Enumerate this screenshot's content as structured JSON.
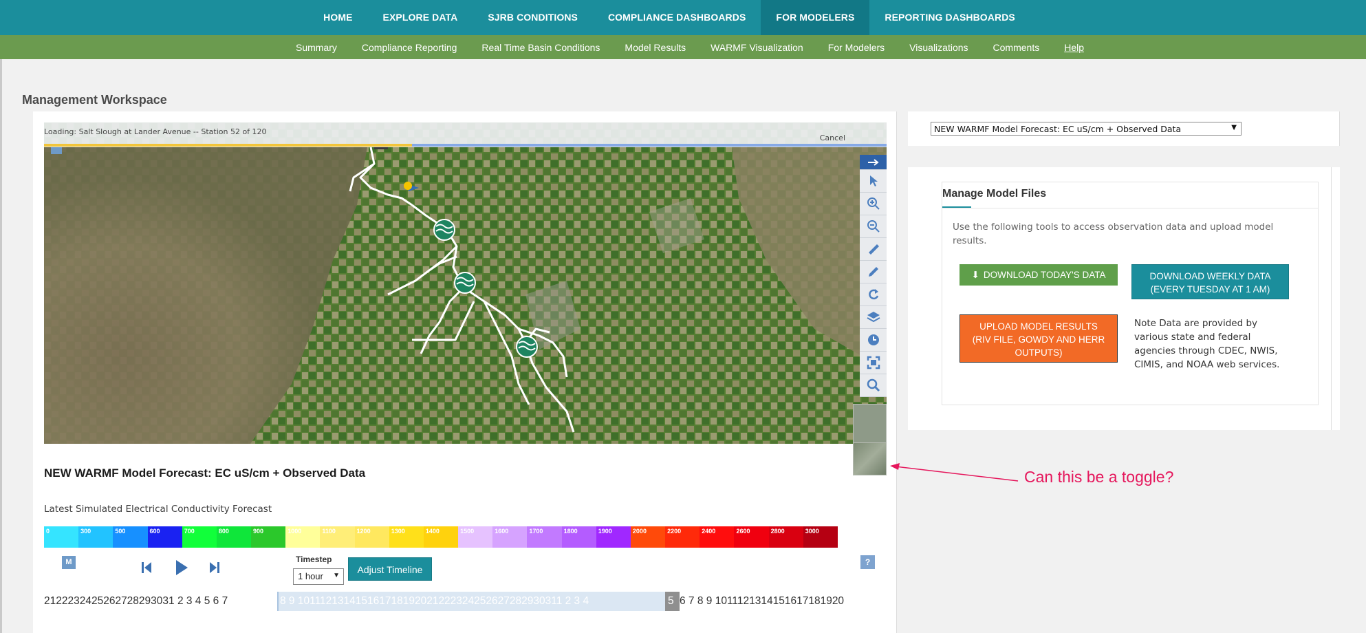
{
  "top_nav": {
    "items": [
      "HOME",
      "EXPLORE DATA",
      "SJRB CONDITIONS",
      "COMPLIANCE DASHBOARDS",
      "FOR MODELERS",
      "REPORTING DASHBOARDS"
    ],
    "active": "FOR MODELERS"
  },
  "sub_nav": {
    "items": [
      "Summary",
      "Compliance Reporting",
      "Real Time Basin Conditions",
      "Model Results",
      "WARMF Visualization",
      "For Modelers",
      "Visualizations",
      "Comments",
      "Help"
    ]
  },
  "workspace_title": "Management Workspace",
  "map": {
    "loading_text": "Loading: Salt Slough at Lander Avenue -- Station 52 of 120",
    "cancel_label": "Cancel",
    "loading_progress": 0.437,
    "tools": [
      "arrow-right-icon",
      "pointer-icon",
      "zoom-in-icon",
      "zoom-out-icon",
      "ruler-icon",
      "pencil-icon",
      "refresh-icon",
      "layers-icon",
      "clock-icon",
      "fullscreen-icon",
      "search-icon"
    ]
  },
  "chart_title": "NEW WARMF Model Forecast: EC uS/cm + Observed Data",
  "legend": {
    "label": "Latest Simulated Electrical Conductivity Forecast",
    "bins": [
      {
        "label": "0",
        "color": "#35e4ff"
      },
      {
        "label": "300",
        "color": "#22c3ff"
      },
      {
        "label": "500",
        "color": "#1790ff"
      },
      {
        "label": "600",
        "color": "#1a22f2"
      },
      {
        "label": "700",
        "color": "#11ff3a"
      },
      {
        "label": "800",
        "color": "#0fe63a"
      },
      {
        "label": "900",
        "color": "#2bc82b"
      },
      {
        "label": "1000",
        "color": "#ffff9a"
      },
      {
        "label": "1100",
        "color": "#ffee78"
      },
      {
        "label": "1200",
        "color": "#ffe85f"
      },
      {
        "label": "1300",
        "color": "#ffe01a"
      },
      {
        "label": "1400",
        "color": "#ffd20d"
      },
      {
        "label": "1500",
        "color": "#e6c2ff"
      },
      {
        "label": "1600",
        "color": "#d6a3ff"
      },
      {
        "label": "1700",
        "color": "#c27aff"
      },
      {
        "label": "1800",
        "color": "#b45cff"
      },
      {
        "label": "1900",
        "color": "#a028ff"
      },
      {
        "label": "2000",
        "color": "#ff4a0a"
      },
      {
        "label": "2200",
        "color": "#ff2a0a"
      },
      {
        "label": "2400",
        "color": "#ff0d0d"
      },
      {
        "label": "2600",
        "color": "#f0000f"
      },
      {
        "label": "2800",
        "color": "#d90010"
      },
      {
        "label": "3000",
        "color": "#b50012"
      }
    ]
  },
  "controls": {
    "m_label": "M",
    "timestep_label": "Timestep",
    "timestep_value": "1 hour",
    "adjust_label": "Adjust Timeline",
    "help_label": "?"
  },
  "timeline": {
    "left": "2122232425262728293031  2  3  4  5  6  7",
    "selected": "8  9  101112131415161718192021222324252627282930311  2  3  4  ",
    "current": "5",
    "right": "6  7  8  9  1011121314151617181920"
  },
  "right_panel": {
    "select_value": "NEW WARMF Model Forecast: EC uS/cm + Observed Data",
    "card_title": "Manage Model Files",
    "description": "Use the following tools to access observation data and upload model results.",
    "download_today": "DOWNLOAD TODAY'S DATA",
    "download_weekly_line1": "DOWNLOAD WEEKLY DATA",
    "download_weekly_line2": "(EVERY TUESDAY AT 1 AM)",
    "upload_line1": "UPLOAD MODEL RESULTS",
    "upload_line2": "(RIV FILE, GOWDY AND HERR",
    "upload_line3": "OUTPUTS)",
    "note": "Note Data are provided by various state and federal agencies through CDEC, NWIS, CIMIS, and NOAA web services."
  },
  "annotation": {
    "text": "Can this be a toggle?",
    "color": "#e5175c"
  }
}
